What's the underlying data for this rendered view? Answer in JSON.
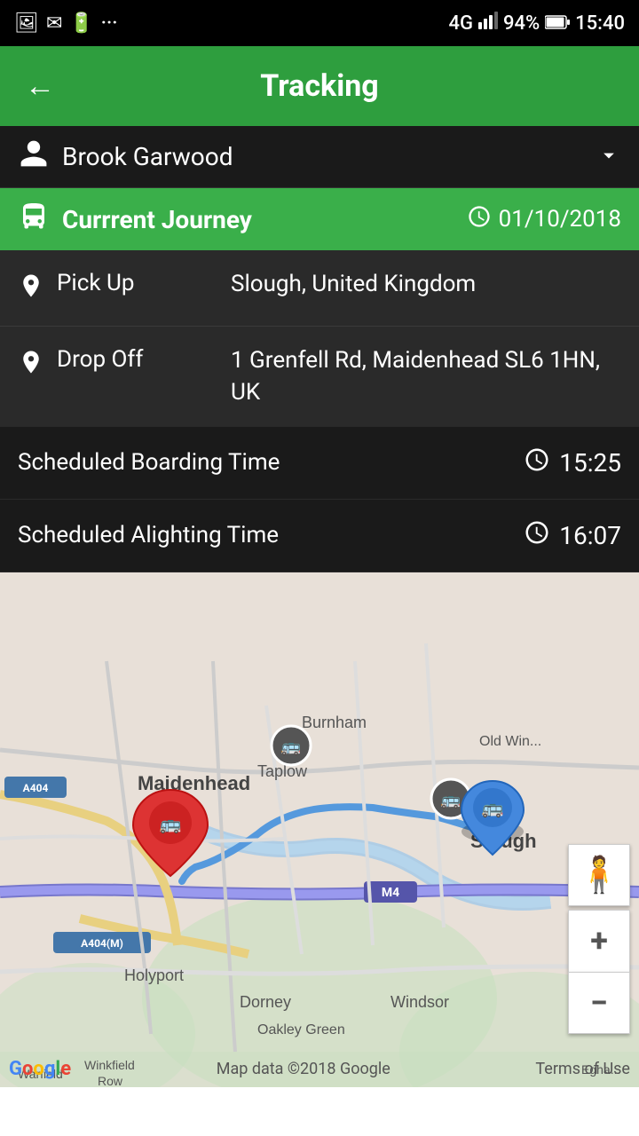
{
  "statusBar": {
    "leftIcons": [
      "image-icon",
      "email-icon",
      "battery-icon",
      "more-icon"
    ],
    "signal": "4G",
    "battery": "94%",
    "time": "15:40"
  },
  "header": {
    "title": "Tracking",
    "backLabel": "←"
  },
  "userSelector": {
    "userName": "Brook Garwood",
    "chevron": "▾"
  },
  "journeyHeader": {
    "label": "Currrent Journey",
    "date": "01/10/2018"
  },
  "journeyDetails": {
    "pickupLabel": "Pick Up",
    "pickupValue": "Slough, United Kingdom",
    "dropoffLabel": "Drop Off",
    "dropoffValue": "1 Grenfell Rd, Maidenhead SL6 1HN, UK"
  },
  "timing": {
    "boardingLabel": "Scheduled Boarding Time",
    "boardingTime": "15:25",
    "alightingLabel": "Scheduled Alighting Time",
    "alightingTime": "16:07"
  },
  "map": {
    "zoomIn": "+",
    "zoomOut": "−",
    "googleText": "Google",
    "mapDataText": "Map data ©2018 Google",
    "termsText": "Terms of Use"
  }
}
